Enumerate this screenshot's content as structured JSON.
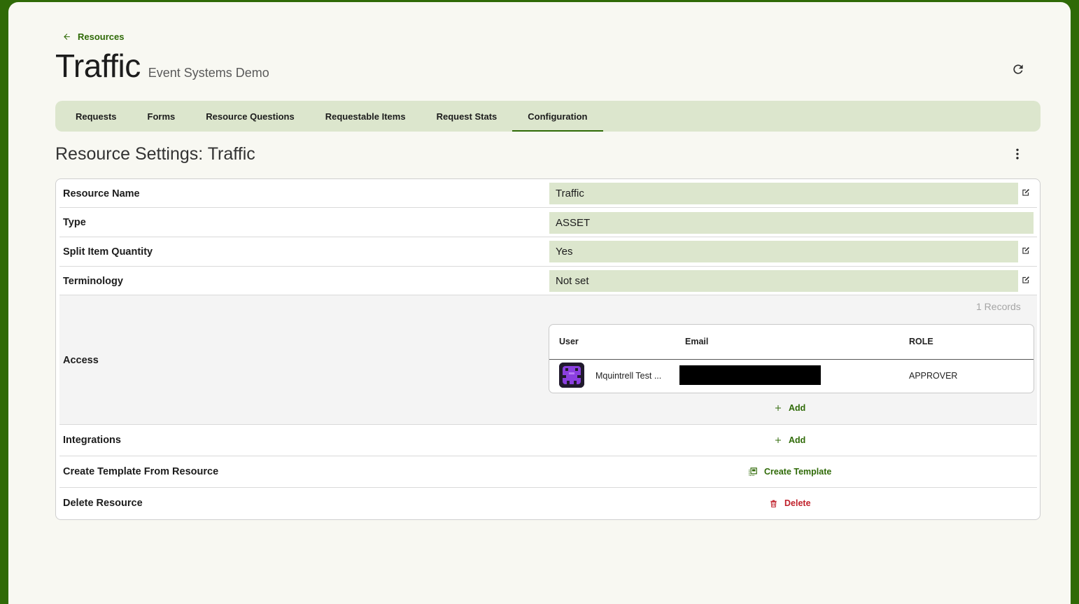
{
  "breadcrumb": {
    "back_label": "Resources"
  },
  "header": {
    "title": "Traffic",
    "subtitle": "Event Systems Demo"
  },
  "tabs": [
    {
      "label": "Requests",
      "active": false
    },
    {
      "label": "Forms",
      "active": false
    },
    {
      "label": "Resource Questions",
      "active": false
    },
    {
      "label": "Requestable Items",
      "active": false
    },
    {
      "label": "Request Stats",
      "active": false
    },
    {
      "label": "Configuration",
      "active": true
    }
  ],
  "section": {
    "title": "Resource Settings: Traffic"
  },
  "settings": {
    "resource_name": {
      "label": "Resource Name",
      "value": "Traffic"
    },
    "type": {
      "label": "Type",
      "value": "ASSET"
    },
    "split_item_quantity": {
      "label": "Split Item Quantity",
      "value": "Yes"
    },
    "terminology": {
      "label": "Terminology",
      "value": "Not set"
    },
    "access": {
      "label": "Access",
      "records_text": "1 Records",
      "columns": {
        "user": "User",
        "email": "Email",
        "role": "ROLE"
      },
      "rows": [
        {
          "user": "Mquintrell Test ...",
          "email": "",
          "role": "APPROVER"
        }
      ],
      "add_label": "Add"
    },
    "integrations": {
      "label": "Integrations",
      "add_label": "Add"
    },
    "create_template": {
      "label": "Create Template From Resource",
      "button_label": "Create Template"
    },
    "delete_resource": {
      "label": "Delete Resource",
      "button_label": "Delete"
    }
  },
  "colors": {
    "brand_green": "#2f6a07",
    "tab_bar": "#dce6cd",
    "danger_red": "#c0212b",
    "page_bg": "#f8f8f2"
  },
  "icons": {
    "back": "arrow-left-icon",
    "refresh": "refresh-icon",
    "more": "more-vertical-icon",
    "edit": "edit-icon",
    "add": "plus-icon",
    "template": "copy-template-icon",
    "delete": "trash-icon"
  }
}
